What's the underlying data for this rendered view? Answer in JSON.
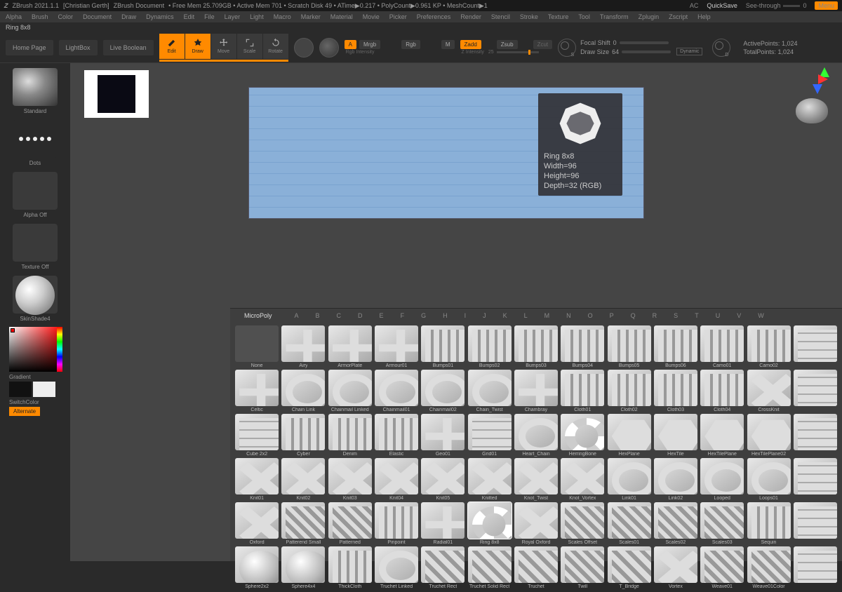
{
  "title": {
    "app": "ZBrush 2021.1.1",
    "user": "[Christian Gerth]",
    "doc": "ZBrush Document",
    "stats": "• Free Mem 25.709GB • Active Mem 701 • Scratch Disk 49 • ATime▶0.217 • PolyCount▶0.961 KP • MeshCount▶1",
    "ac": "AC",
    "quicksave": "QuickSave",
    "see": "See-through",
    "seeval": "0",
    "menu": "Menu"
  },
  "menu": [
    "Alpha",
    "Brush",
    "Color",
    "Document",
    "Draw",
    "Dynamics",
    "Edit",
    "File",
    "Layer",
    "Light",
    "Macro",
    "Marker",
    "Material",
    "Movie",
    "Picker",
    "Preferences",
    "Render",
    "Stencil",
    "Stroke",
    "Texture",
    "Tool",
    "Transform",
    "Zplugin",
    "Zscript",
    "Help"
  ],
  "subtitle": "Ring 8x8",
  "toolbar": {
    "home": "Home Page",
    "lightbox": "LightBox",
    "livebool": "Live Boolean",
    "edit": "Edit",
    "draw": "Draw",
    "move": "Move",
    "scale": "Scale",
    "rotate": "Rotate",
    "a": "A",
    "mrgb": "Mrgb",
    "rgb": "Rgb",
    "m": "M",
    "rgbint": "Rgb Intensity",
    "zadd": "Zadd",
    "zsub": "Zsub",
    "zcut": "Zcut",
    "zint": "Z Intensity",
    "zintval": "25",
    "focal": "Focal Shift",
    "focalval": "0",
    "drawsize": "Draw Size",
    "drawsizeval": "64",
    "dyn": "Dynamic",
    "ap": "ActivePoints:",
    "apval": "1,024",
    "tp": "TotalPoints:",
    "tpval": "1,024"
  },
  "left": {
    "standard": "Standard",
    "dots": "Dots",
    "alphaoff": "Alpha Off",
    "texoff": "Texture Off",
    "mat": "SkinShade4",
    "gradient": "Gradient",
    "switch": "SwitchColor",
    "alt": "Alternate"
  },
  "hover": {
    "name": "Ring 8x8",
    "w": "Width=96",
    "h": "Height=96",
    "d": "Depth=32 (RGB)"
  },
  "mp": {
    "tab": "MicroPoly",
    "letters": [
      "A",
      "B",
      "C",
      "D",
      "E",
      "F",
      "G",
      "H",
      "I",
      "J",
      "K",
      "L",
      "M",
      "N",
      "O",
      "P",
      "Q",
      "R",
      "S",
      "T",
      "U",
      "V",
      "W"
    ],
    "rows": [
      [
        "None",
        "Airy",
        "ArmorPlate",
        "Armour01",
        "Bumps01",
        "Bumps02",
        "Bumps03",
        "Bumps04",
        "Bumps05",
        "Bumps06",
        "Camo01",
        "Camo02",
        ""
      ],
      [
        "Celtic",
        "Chain Link",
        "Chainmail Linked",
        "Chainmail01",
        "Chainmail02",
        "Chain_Twist",
        "Chambray",
        "Cloth01",
        "Cloth02",
        "Cloth03",
        "Cloth04",
        "CrossKnit",
        ""
      ],
      [
        "Cube 2x2",
        "Cyber",
        "Denim",
        "Elastic",
        "Geo01",
        "Grid01",
        "Heart_Chain",
        "HerringBone",
        "HexPlane",
        "HexTile",
        "HexTilePlane",
        "HexTilePlane02",
        ""
      ],
      [
        "Knit01",
        "Knit02",
        "Knit03",
        "Knit04",
        "Knit05",
        "Knitted",
        "Knot_Twist",
        "Knot_Vortex",
        "Link01",
        "Link02",
        "Looped",
        "Loops01",
        ""
      ],
      [
        "Oxford",
        "Patterend Small",
        "Patterned",
        "Pinpoint",
        "Radial01",
        "Ring 8x8",
        "Royal Oxford",
        "Scales Offset",
        "Scales01",
        "Scales02",
        "Scales03",
        "Sequin",
        ""
      ],
      [
        "Sphere2x2",
        "Sphere4x4",
        "ThickCloth",
        "Truchet Linked",
        "Truchet Rect",
        "Truchet Solid Rect",
        "Truchet",
        "Twill",
        "T_Bridge",
        "Vortex",
        "Weave01",
        "Weave01Color",
        ""
      ]
    ]
  }
}
